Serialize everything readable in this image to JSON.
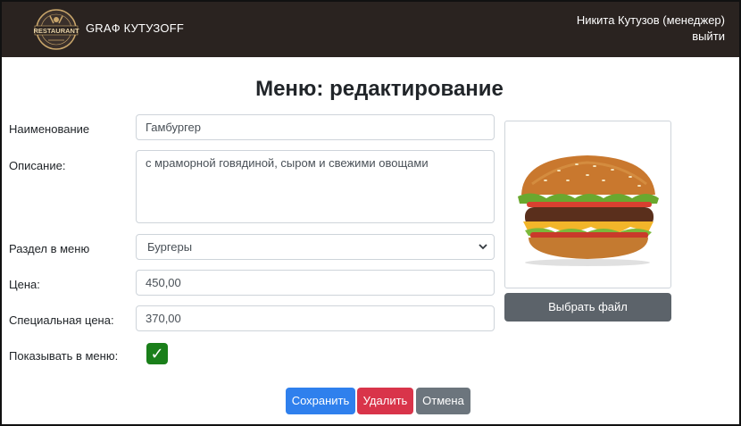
{
  "header": {
    "logo_text": "RESTAURANT",
    "brand": "GRAФ КУТУЗOFF",
    "user_name": "Никита Кутузов (менеджер)",
    "logout_label": "выйти"
  },
  "page_title": "Меню: редактирование",
  "form": {
    "name_label": "Наименование",
    "name_value": "Гамбургер",
    "description_label": "Описание:",
    "description_value": "с мраморной говядиной, сыром и свежими овощами",
    "section_label": "Раздел в меню",
    "section_value": "Бургеры",
    "price_label": "Цена:",
    "price_value": "450,00",
    "special_price_label": "Специальная цена:",
    "special_price_value": "370,00",
    "show_label": "Показывать в меню:",
    "show_checked": true
  },
  "image_panel": {
    "choose_file_label": "Выбрать файл"
  },
  "actions": {
    "save_label": "Сохранить",
    "delete_label": "Удалить",
    "cancel_label": "Отмена"
  },
  "colors": {
    "navbar": "#2a2320",
    "save": "#2f80ed",
    "delete": "#d9344a",
    "cancel": "#6c757d",
    "file_button": "#5c636a",
    "checkbox": "#1a7f1a"
  }
}
